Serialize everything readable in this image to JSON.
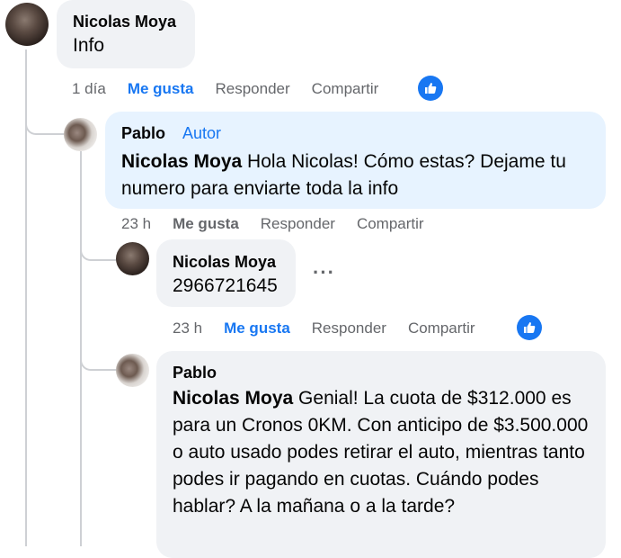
{
  "comments": [
    {
      "author": "Nicolas Moya",
      "text": "Info",
      "time": "1 día",
      "like": "Me gusta",
      "reply": "Responder",
      "share": "Compartir"
    },
    {
      "author": "Pablo",
      "tag": "Autor",
      "mention": "Nicolas Moya",
      "text": " Hola Nicolas! Cómo estas? Dejame tu numero para enviarte toda la info",
      "time": "23 h",
      "like": "Me gusta",
      "reply": "Responder",
      "share": "Compartir"
    },
    {
      "author": "Nicolas Moya",
      "text": "2966721645",
      "more": "···",
      "time": "23 h",
      "like": "Me gusta",
      "reply": "Responder",
      "share": "Compartir"
    },
    {
      "author": "Pablo",
      "mention": "Nicolas Moya",
      "text": " Genial! La cuota de $312.000 es para un Cronos 0KM. Con anticipo de $3.500.000 o auto usado podes retirar el auto, mientras tanto podes ir pagando en cuotas. Cuándo podes hablar? A la mañana o a la tarde?"
    }
  ],
  "colors": {
    "accent": "#1877f2",
    "bubble_gray": "#f0f2f5",
    "bubble_blue": "#e7f3ff",
    "muted": "#65676b"
  },
  "icons": {
    "reaction": "thumbs-up-icon",
    "more": "more-options-icon"
  }
}
